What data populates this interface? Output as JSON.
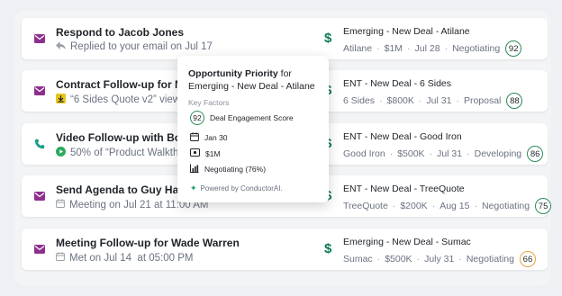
{
  "activities": [
    {
      "icon": "envelope-icon",
      "title": "Respond to Jacob Jones",
      "sub_icon": "reply-icon",
      "subtitle": "Replied to your email on Jul 17",
      "deal": {
        "name": "Emerging - New Deal - Atilane",
        "company": "Atilane",
        "amount": "$1M",
        "date": "Jul 28",
        "stage": "Negotiating",
        "score": "92",
        "score_status": "good"
      }
    },
    {
      "icon": "envelope-icon",
      "title": "Contract Follow-up for Marcus",
      "sub_icon": "download-icon",
      "subtitle": "“6 Sides Quote v2” viewed",
      "deal": {
        "name": "ENT - New Deal - 6 Sides",
        "company": "6 Sides",
        "amount": "$800K",
        "date": "Jul 31",
        "stage": "Proposal",
        "score": "88",
        "score_status": "good"
      }
    },
    {
      "icon": "phone-icon",
      "title": "Video Follow-up with Bob Brady",
      "sub_icon": "play-icon",
      "subtitle": "50% of “Product Walkthrough”",
      "deal": {
        "name": "ENT - New Deal - Good Iron",
        "company": "Good Iron",
        "amount": "$500K",
        "date": "Jul 31",
        "stage": "Developing",
        "score": "86",
        "score_status": "good"
      }
    },
    {
      "icon": "envelope-icon",
      "title": "Send Agenda to Guy Hawkins",
      "sub_icon": "calendar-icon",
      "subtitle": "Meeting on Jul 21 at 11:00 AM",
      "deal": {
        "name": "ENT - New Deal - TreeQuote",
        "company": "TreeQuote",
        "amount": "$200K",
        "date": "Aug 15",
        "stage": "Negotiating",
        "score": "75",
        "score_status": "good"
      }
    },
    {
      "icon": "envelope-icon",
      "title": "Meeting Follow-up for Wade Warren",
      "sub_icon": "calendar-icon",
      "subtitle": "Met on Jul 14  at 05:00 PM",
      "deal": {
        "name": "Emerging - New Deal - Sumac",
        "company": "Sumac",
        "amount": "$500K",
        "date": "July 31",
        "stage": "Negotiating",
        "score": "66",
        "score_status": "warn"
      }
    }
  ],
  "deal_symbol": "$",
  "popover": {
    "title_bold": "Opportunity Priority",
    "title_rest": " for Emerging - New Deal - Atilane",
    "key_factors_label": "Key Factors",
    "engagement_score": "92",
    "engagement_label": "Deal Engagement Score",
    "date": "Jan 30",
    "amount": "$1M",
    "stage": "Negotiating (76%)",
    "footer": "Powered by ConductorAI."
  },
  "colors": {
    "accent_purple": "#8e2f8e",
    "phone_teal": "#1a9e8e",
    "dollar_green": "#0f7a52",
    "score_good": "#2e8b57",
    "score_warn": "#e6a23c"
  }
}
